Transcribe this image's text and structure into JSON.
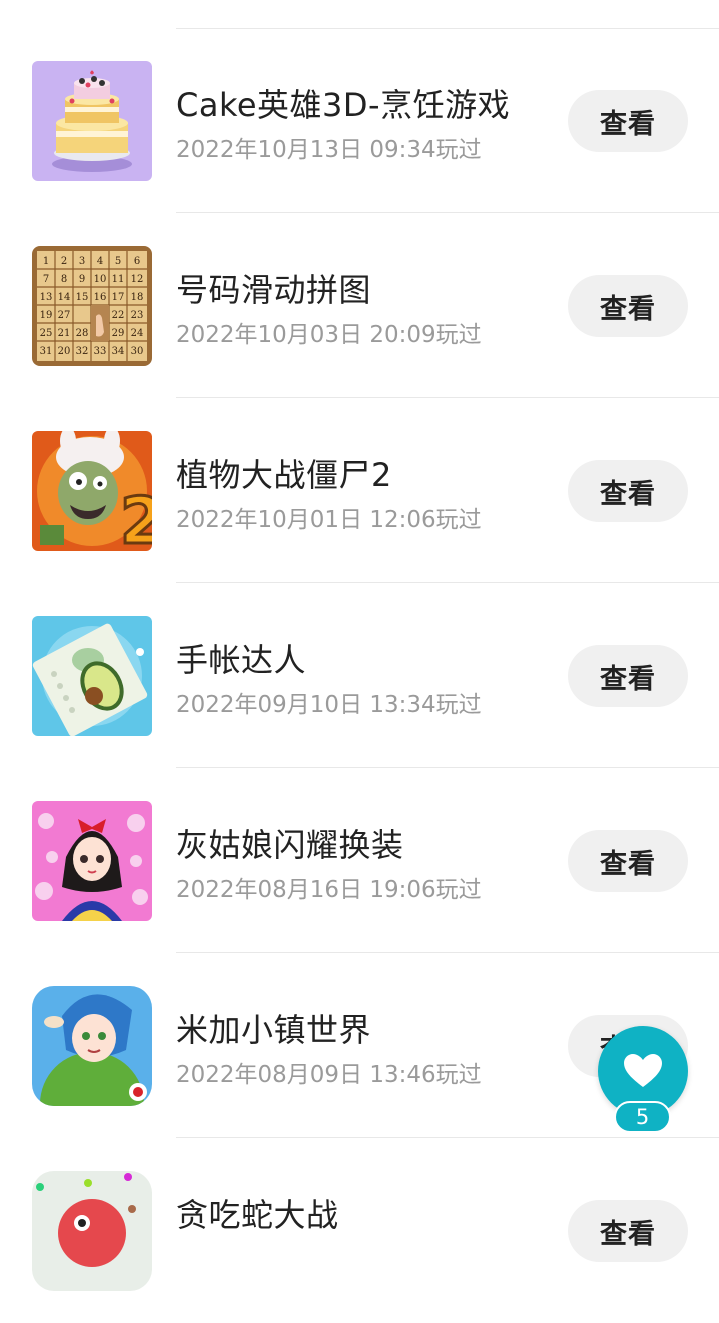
{
  "games": [
    {
      "title": "Cake英雄3D-烹饪游戏",
      "played": "2022年10月13日 09:34玩过",
      "button": "查看",
      "icon": "cake-game-icon"
    },
    {
      "title": "号码滑动拼图",
      "played": "2022年10月03日 20:09玩过",
      "button": "查看",
      "icon": "number-puzzle-game-icon"
    },
    {
      "title": "植物大战僵尸2",
      "played": "2022年10月01日 12:06玩过",
      "button": "查看",
      "icon": "plants-vs-zombies-game-icon"
    },
    {
      "title": "手帐达人",
      "played": "2022年09月10日 13:34玩过",
      "button": "查看",
      "icon": "journal-game-icon"
    },
    {
      "title": "灰姑娘闪耀换装",
      "played": "2022年08月16日 19:06玩过",
      "button": "查看",
      "icon": "dress-up-game-icon"
    },
    {
      "title": "米加小镇世界",
      "played": "2022年08月09日 13:46玩过",
      "button": "查看",
      "icon": "miga-town-game-icon"
    },
    {
      "title": "贪吃蛇大战",
      "played": "",
      "button": "查看",
      "icon": "snake-game-icon"
    }
  ],
  "favorite": {
    "count": "5",
    "icon": "heart-icon"
  },
  "colors": {
    "accent": "#0fb2c4",
    "button_bg": "#f0f0f0",
    "title": "#222222",
    "date": "#9a9a9a",
    "divider": "#e8e8e8"
  }
}
